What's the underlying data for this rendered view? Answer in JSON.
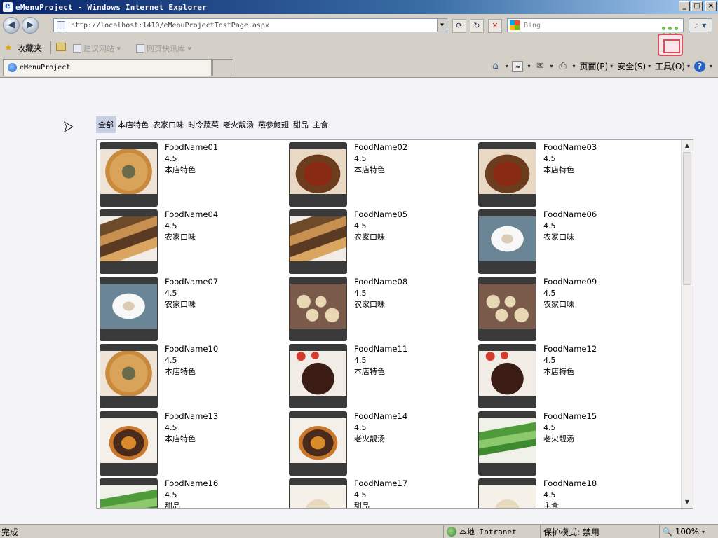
{
  "window": {
    "title": "eMenuProject - Windows Internet Explorer",
    "buttons": {
      "minimize": "_",
      "maximize": "□",
      "close": "×"
    }
  },
  "toolbar": {
    "back_glyph": "◀",
    "forward_glyph": "▶",
    "address": "http://localhost:1410/eMenuProjectTestPage.aspx",
    "address_dropdown": "▼",
    "refresh_glyph": "⟳",
    "go_glyph": "↻",
    "stop_glyph": "✕",
    "search_placeholder": "Bing",
    "search_glyph": "⌕ ▾"
  },
  "favorites": {
    "label": "收藏夹",
    "links": [
      {
        "label": "建议网站 ▾"
      },
      {
        "label": "网页快讯库 ▾"
      }
    ]
  },
  "tabs": [
    {
      "label": "eMenuProject"
    }
  ],
  "command_bar": {
    "page": "页面(P)",
    "safety": "安全(S)",
    "tools": "工具(O)",
    "help": "?"
  },
  "categories": [
    "全部",
    "本店特色",
    "农家口味",
    "时令蔬菜",
    "老火靓汤",
    "燕参鲍翅",
    "甜品",
    "主食"
  ],
  "active_category": "全部",
  "food_items": [
    {
      "name": "FoodName01",
      "rating": "4.5",
      "category": "本店特色",
      "image": "fried-ring-plate"
    },
    {
      "name": "FoodName02",
      "rating": "4.5",
      "category": "本店特色",
      "image": "braised-pork-pot"
    },
    {
      "name": "FoodName03",
      "rating": "4.5",
      "category": "本店特色",
      "image": "braised-pork-pot"
    },
    {
      "name": "FoodName04",
      "rating": "4.5",
      "category": "农家口味",
      "image": "grilled-fish"
    },
    {
      "name": "FoodName05",
      "rating": "4.5",
      "category": "农家口味",
      "image": "grilled-fish"
    },
    {
      "name": "FoodName06",
      "rating": "4.5",
      "category": "农家口味",
      "image": "white-platter"
    },
    {
      "name": "FoodName07",
      "rating": "4.5",
      "category": "农家口味",
      "image": "white-platter"
    },
    {
      "name": "FoodName08",
      "rating": "4.5",
      "category": "农家口味",
      "image": "steamed-buns"
    },
    {
      "name": "FoodName09",
      "rating": "4.5",
      "category": "农家口味",
      "image": "steamed-buns"
    },
    {
      "name": "FoodName10",
      "rating": "4.5",
      "category": "本店特色",
      "image": "fried-ring-plate"
    },
    {
      "name": "FoodName11",
      "rating": "4.5",
      "category": "本店特色",
      "image": "dark-braised-meat"
    },
    {
      "name": "FoodName12",
      "rating": "4.5",
      "category": "本店特色",
      "image": "dark-braised-meat"
    },
    {
      "name": "FoodName13",
      "rating": "4.5",
      "category": "本店特色",
      "image": "mushroom-stirfry"
    },
    {
      "name": "FoodName14",
      "rating": "4.5",
      "category": "老火靓汤",
      "image": "mushroom-stirfry"
    },
    {
      "name": "FoodName15",
      "rating": "4.5",
      "category": "老火靓汤",
      "image": "green-vegetables"
    },
    {
      "name": "FoodName16",
      "rating": "4.5",
      "category": "甜品",
      "image": "green-vegetables"
    },
    {
      "name": "FoodName17",
      "rating": "4.5",
      "category": "甜品",
      "image": "light-plate"
    },
    {
      "name": "FoodName18",
      "rating": "4.5",
      "category": "主食",
      "image": "light-plate"
    }
  ],
  "status": {
    "text": "完成",
    "zone": "本地 Intranet",
    "protected_mode": "保护模式: 禁用",
    "zoom": "100%"
  },
  "colors": {
    "titlebar": "#0a246a",
    "active_category_bg": "#c7cfe4",
    "content_bg": "#f4f3f8"
  }
}
